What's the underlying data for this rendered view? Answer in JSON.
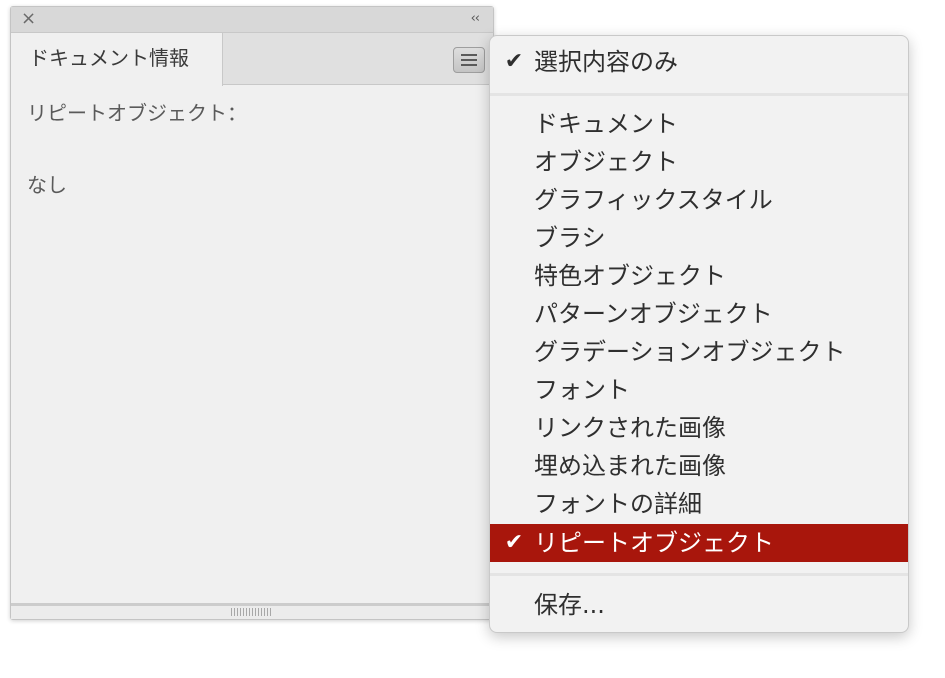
{
  "panel": {
    "close_glyph": "×",
    "collapse_glyph": "‹‹",
    "tab_label": "ドキュメント情報",
    "content_label": "リピートオブジェクト：",
    "content_value": "なし"
  },
  "menu": {
    "top_item": {
      "label": "選択内容のみ",
      "checked": true
    },
    "items": [
      {
        "label": "ドキュメント",
        "checked": false
      },
      {
        "label": "オブジェクト",
        "checked": false
      },
      {
        "label": "グラフィックスタイル",
        "checked": false
      },
      {
        "label": "ブラシ",
        "checked": false
      },
      {
        "label": "特色オブジェクト",
        "checked": false
      },
      {
        "label": "パターンオブジェクト",
        "checked": false
      },
      {
        "label": "グラデーションオブジェクト",
        "checked": false
      },
      {
        "label": "フォント",
        "checked": false
      },
      {
        "label": "リンクされた画像",
        "checked": false
      },
      {
        "label": "埋め込まれた画像",
        "checked": false
      },
      {
        "label": "フォントの詳細",
        "checked": false
      },
      {
        "label": "リピートオブジェクト",
        "checked": true,
        "highlighted": true
      }
    ],
    "save_item": {
      "label": "保存..."
    },
    "check_glyph": "✔",
    "highlight_color": "#a8160c"
  }
}
